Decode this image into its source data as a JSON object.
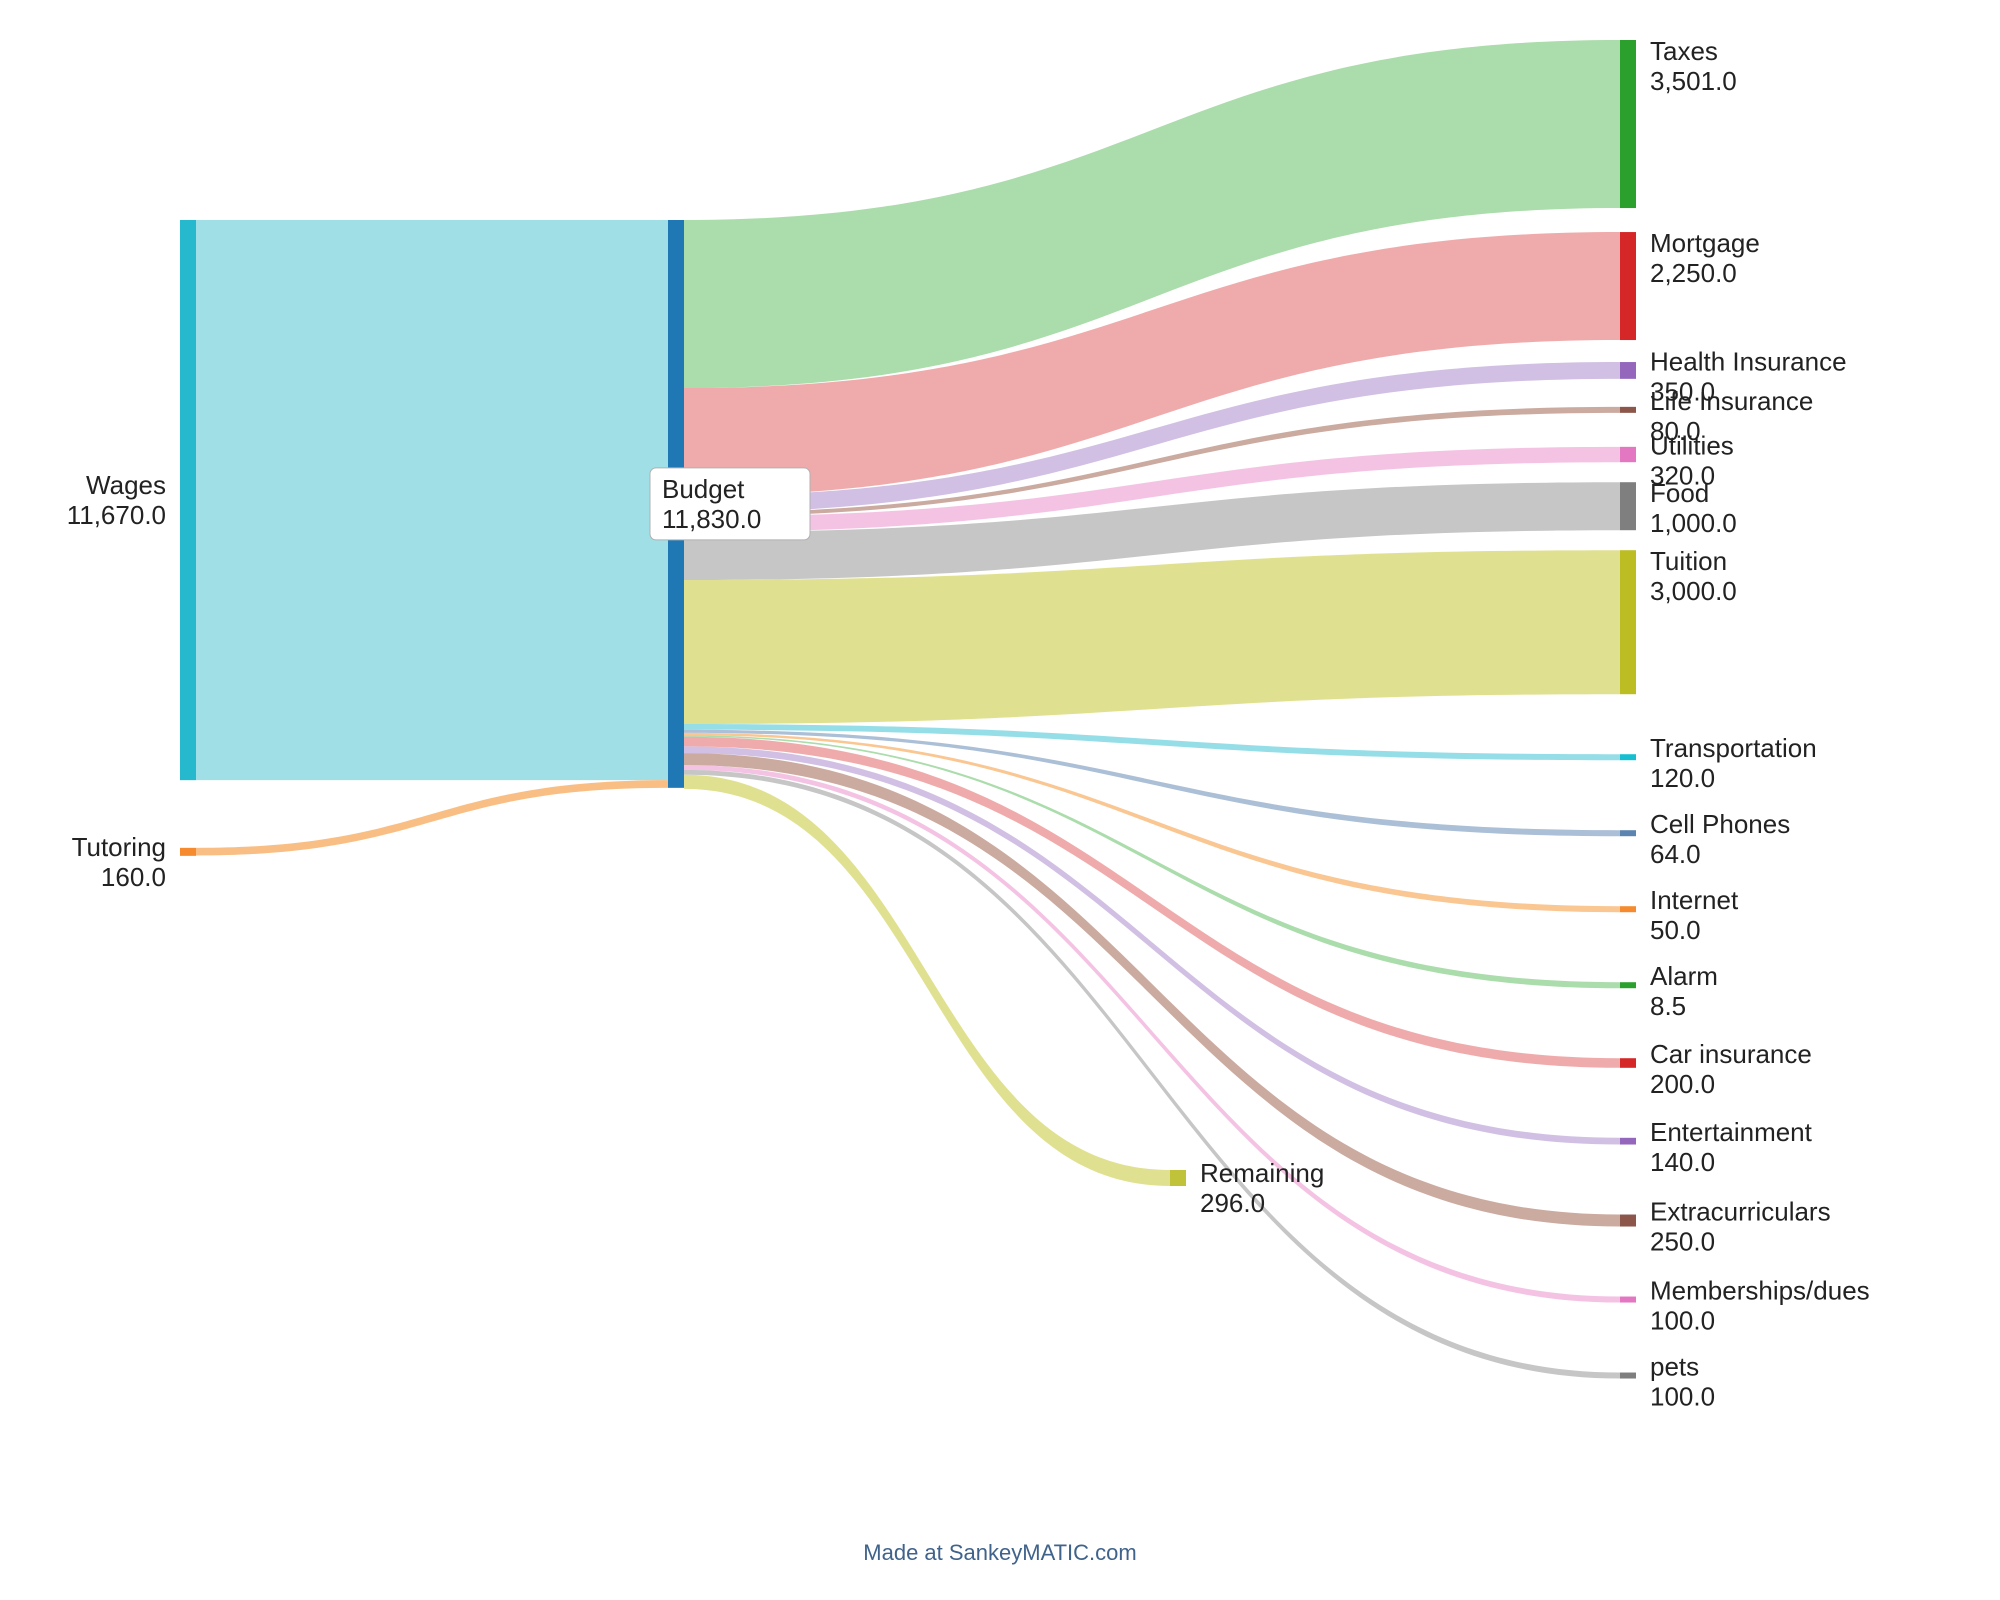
{
  "chart_data": {
    "type": "sankey",
    "footer": "Made at SankeyMATIC.com",
    "nodes": {
      "wages": {
        "label": "Wages",
        "value": "11,670.0",
        "num": 11670,
        "color": "#26b8cc"
      },
      "tutoring": {
        "label": "Tutoring",
        "value": "160.0",
        "num": 160,
        "color": "#f58a2e"
      },
      "budget": {
        "label": "Budget",
        "value": "11,830.0",
        "num": 11830,
        "color": "#1f77b4"
      },
      "remaining": {
        "label": "Remaining",
        "value": "296.0",
        "num": 296,
        "color": "#c0c23a"
      },
      "taxes": {
        "label": "Taxes",
        "value": "3,501.0",
        "num": 3501,
        "color": "#2ca02c"
      },
      "mortgage": {
        "label": "Mortgage",
        "value": "2,250.0",
        "num": 2250,
        "color": "#d62728"
      },
      "health": {
        "label": "Health Insurance",
        "value": "350.0",
        "num": 350,
        "color": "#9467bd"
      },
      "life": {
        "label": "Life Insurance",
        "value": "80.0",
        "num": 80,
        "color": "#8c564b"
      },
      "utilities": {
        "label": "Utilities",
        "value": "320.0",
        "num": 320,
        "color": "#e377c2"
      },
      "food": {
        "label": "Food",
        "value": "1,000.0",
        "num": 1000,
        "color": "#7f7f7f"
      },
      "tuition": {
        "label": "Tuition",
        "value": "3,000.0",
        "num": 3000,
        "color": "#bcbd22"
      },
      "transport": {
        "label": "Transportation",
        "value": "120.0",
        "num": 120,
        "color": "#17becf"
      },
      "cell": {
        "label": "Cell Phones",
        "value": "64.0",
        "num": 64,
        "color": "#5b84b1"
      },
      "internet": {
        "label": "Internet",
        "value": "50.0",
        "num": 50,
        "color": "#f58a2e"
      },
      "alarm": {
        "label": "Alarm",
        "value": "8.5",
        "num": 8.5,
        "color": "#2ca02c"
      },
      "carins": {
        "label": "Car insurance",
        "value": "200.0",
        "num": 200,
        "color": "#d62728"
      },
      "entertain": {
        "label": "Entertainment",
        "value": "140.0",
        "num": 140,
        "color": "#9467bd"
      },
      "extra": {
        "label": "Extracurriculars",
        "value": "250.0",
        "num": 250,
        "color": "#8c564b"
      },
      "member": {
        "label": "Memberships/dues",
        "value": "100.0",
        "num": 100,
        "color": "#e377c2"
      },
      "pets": {
        "label": "pets",
        "value": "100.0",
        "num": 100,
        "color": "#7f7f7f"
      }
    },
    "flows": [
      {
        "source": "wages",
        "target": "budget",
        "value": 11670,
        "color": "#8fd9e2"
      },
      {
        "source": "tutoring",
        "target": "budget",
        "value": 160,
        "color": "#f8b36d"
      },
      {
        "source": "budget",
        "target": "taxes",
        "value": 3501,
        "color": "#8fd08f"
      },
      {
        "source": "budget",
        "target": "mortgage",
        "value": 2250,
        "color": "#ea8f8f"
      },
      {
        "source": "budget",
        "target": "health",
        "value": 350,
        "color": "#c2abda"
      },
      {
        "source": "budget",
        "target": "life",
        "value": 80,
        "color": "#b98d80"
      },
      {
        "source": "budget",
        "target": "utilities",
        "value": 320,
        "color": "#f0afd9"
      },
      {
        "source": "budget",
        "target": "food",
        "value": 1000,
        "color": "#b3b3b3"
      },
      {
        "source": "budget",
        "target": "tuition",
        "value": 3000,
        "color": "#d6d76b"
      },
      {
        "source": "budget",
        "target": "transport",
        "value": 120,
        "color": "#73d3df"
      },
      {
        "source": "budget",
        "target": "cell",
        "value": 64,
        "color": "#8fa9c9"
      },
      {
        "source": "budget",
        "target": "internet",
        "value": 50,
        "color": "#f8b36d"
      },
      {
        "source": "budget",
        "target": "alarm",
        "value": 8.5,
        "color": "#8fd08f"
      },
      {
        "source": "budget",
        "target": "carins",
        "value": 200,
        "color": "#ea8f8f"
      },
      {
        "source": "budget",
        "target": "entertain",
        "value": 140,
        "color": "#c2abda"
      },
      {
        "source": "budget",
        "target": "extra",
        "value": 250,
        "color": "#b98d80"
      },
      {
        "source": "budget",
        "target": "member",
        "value": 100,
        "color": "#f0afd9"
      },
      {
        "source": "budget",
        "target": "pets",
        "value": 100,
        "color": "#b3b3b3"
      },
      {
        "source": "budget",
        "target": "remaining",
        "value": 296,
        "color": "#d6d76b"
      }
    ]
  }
}
